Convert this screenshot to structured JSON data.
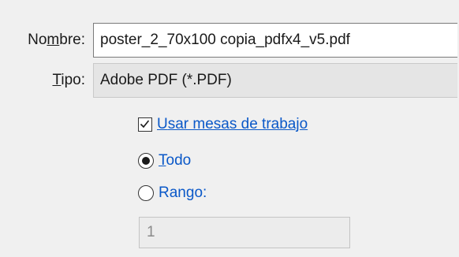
{
  "save_dialog": {
    "filename_label_pre": "No",
    "filename_label_mnemonic": "m",
    "filename_label_post": "bre:",
    "filename_value": "poster_2_70x100 copia_pdfx4_v5.pdf",
    "filetype_label_mnemonic": "T",
    "filetype_label_post": "ipo:",
    "filetype_value": "Adobe PDF (*.PDF)"
  },
  "options": {
    "artboards_label_mnemonic": "U",
    "artboards_label_post": "sar mesas de trabajo",
    "artboards_checked": true,
    "all_label_mnemonic": "T",
    "all_label_post": "odo",
    "all_selected": true,
    "range_label_pre": "Ran",
    "range_label_mnemonic": "g",
    "range_label_post": "o:",
    "range_selected": false,
    "range_value": "1"
  }
}
